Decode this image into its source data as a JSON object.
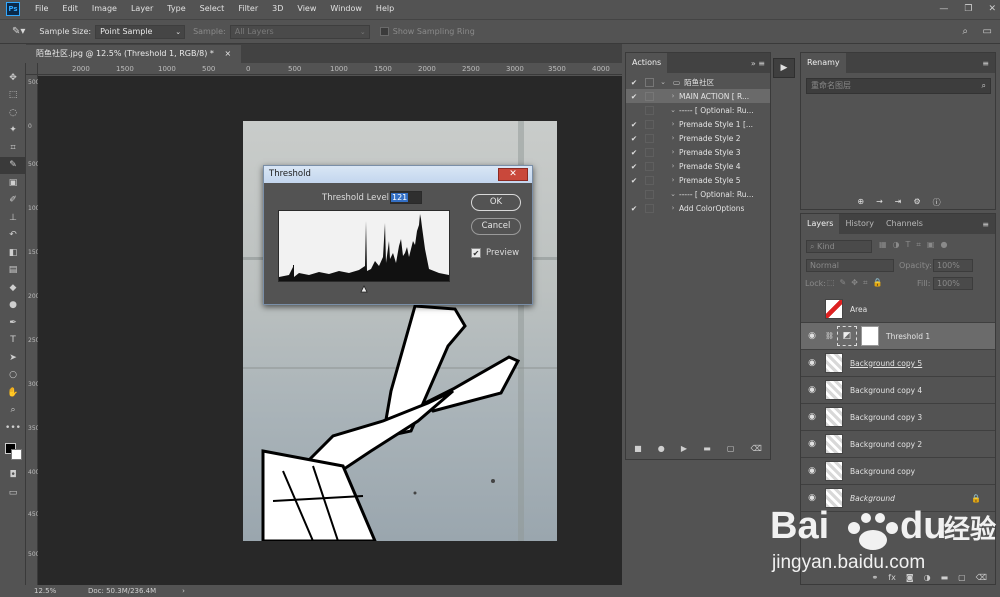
{
  "menubar": {
    "items": [
      "File",
      "Edit",
      "Image",
      "Layer",
      "Type",
      "Select",
      "Filter",
      "3D",
      "View",
      "Window",
      "Help"
    ],
    "logo": "Ps",
    "window_controls": [
      "minimize-icon",
      "restore-icon",
      "close-icon"
    ]
  },
  "options": {
    "sample_size_label": "Sample Size:",
    "sample_size_value": "Point Sample",
    "sample_label": "Sample:",
    "sample_value": "All Layers",
    "sampling_ring_label": "Show Sampling Ring"
  },
  "document": {
    "tab_title": "陌鱼社区.jpg @ 12.5% (Threshold 1, RGB/8) *",
    "close_glyph": "×"
  },
  "ruler": {
    "h_ticks": [
      "2000",
      "1500",
      "1000",
      "500",
      "0",
      "500",
      "1000",
      "1500",
      "2000",
      "2500",
      "3000",
      "3500",
      "4000"
    ],
    "v_ticks": [
      "500",
      "0",
      "500",
      "1000",
      "1500",
      "2000",
      "2500",
      "3000",
      "3500",
      "4000",
      "4500",
      "5000"
    ]
  },
  "status": {
    "zoom": "12.5%",
    "doc": "Doc: 50.3M/236.4M"
  },
  "threshold_dialog": {
    "title": "Threshold",
    "level_label": "Threshold Level:",
    "level_value": "121",
    "ok": "OK",
    "cancel": "Cancel",
    "preview": "Preview",
    "preview_checked": true
  },
  "actions_panel": {
    "tab": "Actions",
    "rows": [
      {
        "label": "陌鱼社区",
        "check": true,
        "box": true,
        "arrow": "⌄",
        "indent": 0,
        "folder": true
      },
      {
        "label": "MAIN ACTION [ R...",
        "check": true,
        "box": true,
        "arrow": "›",
        "indent": 1,
        "selected": true
      },
      {
        "label": "----- [ Optional: Ru...",
        "check": false,
        "box": false,
        "arrow": "⌄",
        "indent": 1
      },
      {
        "label": "Premade Style 1 [...",
        "check": true,
        "box": false,
        "arrow": "›",
        "indent": 1
      },
      {
        "label": "Premade Style 2",
        "check": true,
        "box": false,
        "arrow": "›",
        "indent": 1
      },
      {
        "label": "Premade Style 3",
        "check": true,
        "box": false,
        "arrow": "›",
        "indent": 1
      },
      {
        "label": "Premade Style 4",
        "check": true,
        "box": false,
        "arrow": "›",
        "indent": 1
      },
      {
        "label": "Premade Style 5",
        "check": true,
        "box": false,
        "arrow": "›",
        "indent": 1
      },
      {
        "label": "----- [ Optional: Ru...",
        "check": false,
        "box": false,
        "arrow": "⌄",
        "indent": 1
      },
      {
        "label": "Add ColorOptions",
        "check": true,
        "box": false,
        "arrow": "›",
        "indent": 1
      }
    ]
  },
  "renamy_panel": {
    "tab": "Renamy",
    "search_placeholder": "重命名图层"
  },
  "layers_panel": {
    "tabs": [
      "Layers",
      "History",
      "Channels"
    ],
    "kind_label": "Kind",
    "blend_mode": "Normal",
    "opacity_label": "Opacity:",
    "opacity_value": "100%",
    "lock_label": "Lock:",
    "fill_label": "Fill:",
    "fill_value": "100%",
    "layers": [
      {
        "name": "Area",
        "visible": false,
        "style": "",
        "selected": false
      },
      {
        "name": "Threshold 1",
        "visible": true,
        "style": "",
        "selected": true,
        "adjustment": true
      },
      {
        "name": "Background copy 5",
        "visible": true,
        "style": "u",
        "selected": false
      },
      {
        "name": "Background copy 4",
        "visible": true,
        "style": "",
        "selected": false
      },
      {
        "name": "Background copy 3",
        "visible": true,
        "style": "",
        "selected": false
      },
      {
        "name": "Background copy 2",
        "visible": true,
        "style": "",
        "selected": false
      },
      {
        "name": "Background copy",
        "visible": true,
        "style": "",
        "selected": false
      },
      {
        "name": "Background",
        "visible": true,
        "style": "i",
        "selected": false,
        "locked": true
      }
    ]
  },
  "watermark": {
    "brand": "Bai",
    "brand2": "du",
    "cn": "经验",
    "url": "jingyan.baidu.com"
  },
  "colors": {
    "ui_bg": "#535353",
    "panel_dark": "#424242",
    "canvas_bg": "#282828",
    "selection": "#6b6b6b",
    "accent_blue": "#31a8ff"
  }
}
